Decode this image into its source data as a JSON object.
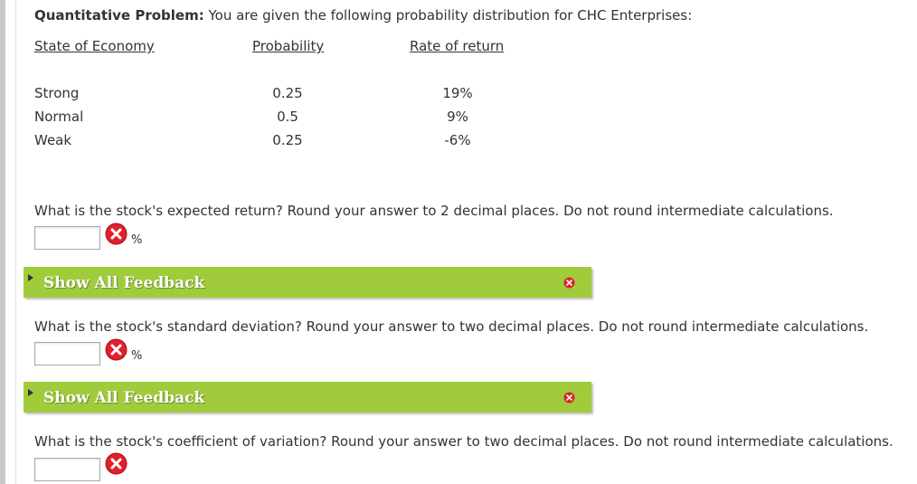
{
  "problem": {
    "title_bold": "Quantitative Problem:",
    "title_rest": " You are given the following probability distribution for CHC Enterprises:"
  },
  "table": {
    "headers": [
      "State of Economy",
      "Probability",
      "Rate of return"
    ],
    "rows": [
      [
        "Strong",
        "0.25",
        "19%"
      ],
      [
        "Normal",
        "0.5",
        "9%"
      ],
      [
        "Weak",
        "0.25",
        "-6%"
      ]
    ]
  },
  "questions": [
    {
      "text": "What is the stock's expected return? Round your answer to 2 decimal places. Do not round intermediate calculations.",
      "value": "",
      "unit": "%"
    },
    {
      "text": "What is the stock's standard deviation? Round your answer to two decimal places. Do not round intermediate calculations.",
      "value": "",
      "unit": "%"
    },
    {
      "text": "What is the stock's coefficient of variation? Round your answer to two decimal places. Do not round intermediate calculations.",
      "value": "",
      "unit": ""
    }
  ],
  "feedback": {
    "label": "Show All Feedback"
  },
  "icons": {
    "incorrect": "x-circle-icon",
    "feedback_close": "close-icon",
    "feedback_toggle": "triangle-right-icon"
  },
  "colors": {
    "feedback_bar": "#a0cc3c",
    "incorrect_red": "#e0202b"
  }
}
